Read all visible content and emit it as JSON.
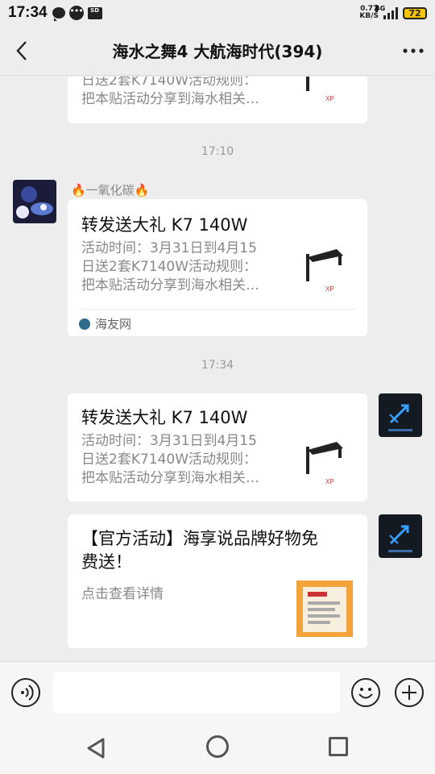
{
  "status_bar": {
    "time": "17:34",
    "speed_value": "0.77",
    "speed_unit": "KB/S",
    "network": "4G",
    "battery": "72"
  },
  "header": {
    "title": "海水之舞4 大航海时代(394)"
  },
  "messages": [
    {
      "type": "link-card",
      "side": "left",
      "partial": true,
      "desc_line1": "日送2套K7140W活动规则：",
      "desc_line2": "把本贴活动分享到海水相关…"
    },
    {
      "type": "timestamp",
      "text": "17:10"
    },
    {
      "type": "link-card",
      "side": "left",
      "sender": "🔥一氧化碳🔥",
      "title": "转发送大礼 K7 140W",
      "desc_line1": "活动时间：3月31日到4月15",
      "desc_line2": "日送2套K7140W活动规则：",
      "desc_line3": "把本贴活动分享到海水相关…",
      "source": "海友网"
    },
    {
      "type": "timestamp",
      "text": "17:34"
    },
    {
      "type": "link-card",
      "side": "right",
      "title": "转发送大礼 K7 140W",
      "desc_line1": "活动时间：3月31日到4月15",
      "desc_line2": "日送2套K7140W活动规则：",
      "desc_line3": "把本贴活动分享到海水相关…"
    },
    {
      "type": "link-card",
      "side": "right",
      "title_line1": "【官方活动】海享说品牌好物免",
      "title_line2": "费送！",
      "desc_line1": "点击查看详情"
    }
  ],
  "colors": {
    "background": "#ededed",
    "card": "#ffffff",
    "battery": "#f3c400"
  },
  "icons": [
    "back-icon",
    "more-icon",
    "voice-icon",
    "emoji-icon",
    "plus-icon",
    "nav-back-icon",
    "nav-home-icon",
    "nav-recent-icon"
  ]
}
